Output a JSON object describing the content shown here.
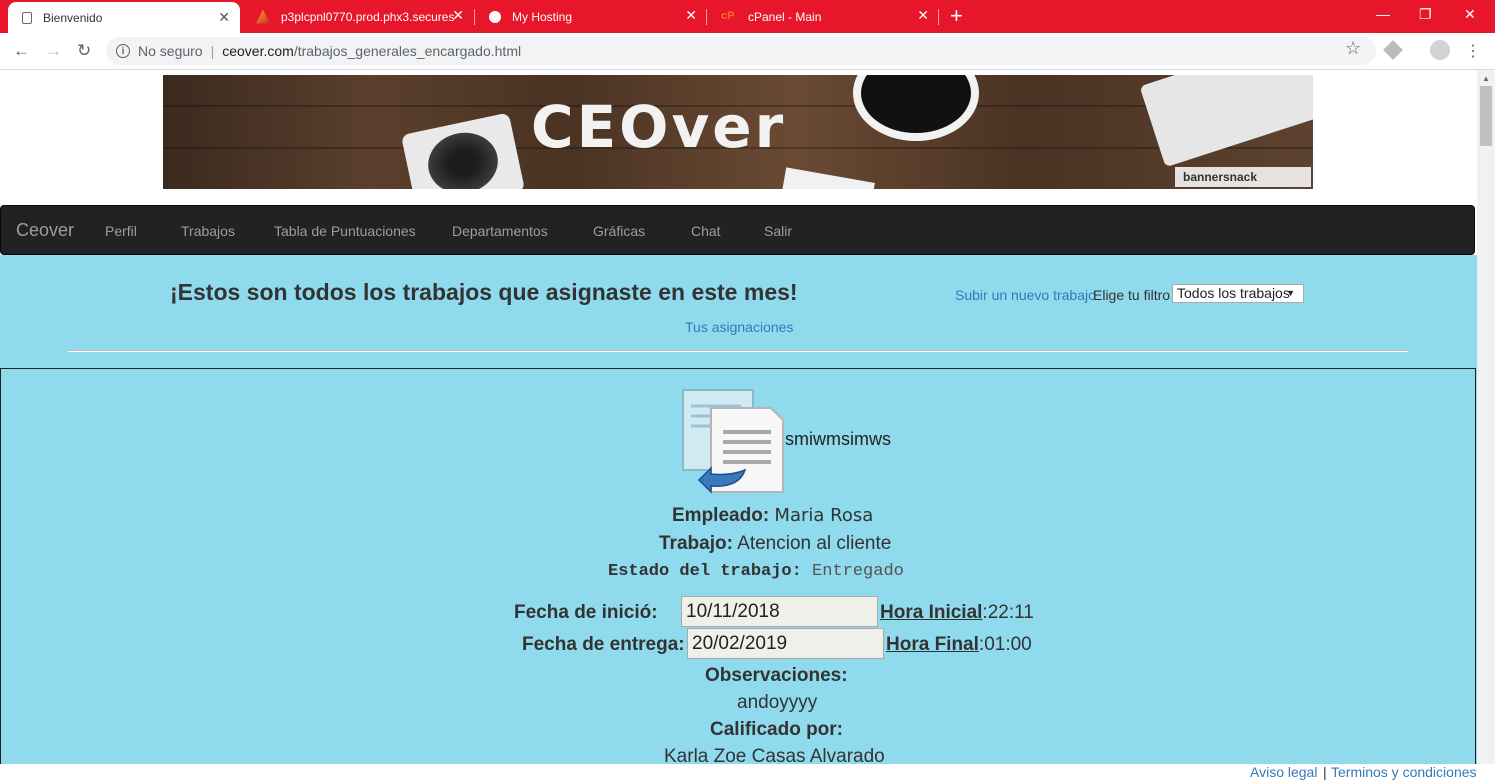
{
  "browser": {
    "tabs": [
      {
        "title": "Bienvenido",
        "active": true
      },
      {
        "title": "p3plcpnl0770.prod.phx3.secures",
        "active": false
      },
      {
        "title": "My Hosting",
        "active": false
      },
      {
        "title": "cPanel - Main",
        "active": false
      }
    ],
    "security_label": "No seguro",
    "url_domain": "ceover.com",
    "url_path": "/trabajos_generales_encargado.html"
  },
  "banner": {
    "logo_text": "CEOver",
    "badge_text": "bannersnack"
  },
  "nav": {
    "brand": "Ceover",
    "items": [
      "Perfil",
      "Trabajos",
      "Tabla de Puntuaciones",
      "Departamentos",
      "Gráficas",
      "Chat",
      "Salir"
    ]
  },
  "header": {
    "headline": "¡Estos son todos los trabajos que asignaste en este mes!",
    "upload_link": "Subir un nuevo trabajo",
    "filter_label": "Elige tu filtro",
    "filter_value": "Todos los trabajos",
    "assignments_link": "Tus asignaciones"
  },
  "job": {
    "file_name": "smiwmsimws",
    "employee_label": "Empleado",
    "employee": "Maria Rosa",
    "job_label": "Trabajo",
    "job": "Atencion al cliente",
    "status_label": "Estado del trabajo",
    "status": "Entregado",
    "start_label": "Fecha de inició:",
    "start_date": "10/11/2018",
    "start_time_label": "Hora Inicial",
    "start_time": "22:11",
    "due_label": "Fecha de entrega:",
    "due_date": "20/02/2019",
    "end_time_label": "Hora Final",
    "end_time": "01:00",
    "observations_label": "Observaciones:",
    "observations": "andoyyyy",
    "rated_by_label": "Calificado por:",
    "rated_by": "Karla Zoe Casas Alvarado"
  },
  "footer": {
    "legal": "Aviso legal",
    "terms": "Terminos y condiciones"
  },
  "colors": {
    "tabbar": "#e8162a",
    "content_bg": "#8fdbed",
    "navbar": "#222222",
    "link": "#337ab7"
  }
}
